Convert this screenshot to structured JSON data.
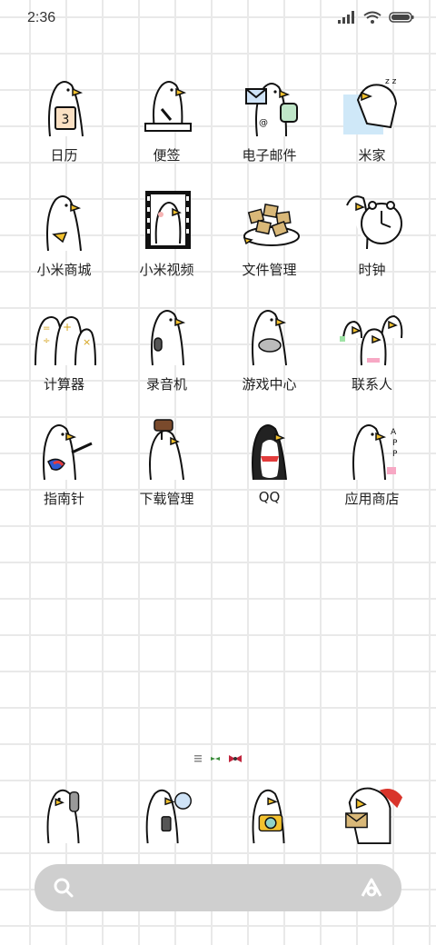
{
  "status_bar": {
    "time": "2:36",
    "icons": [
      "signal-icon",
      "wifi-icon",
      "battery-icon"
    ]
  },
  "apps": [
    {
      "label": "日历",
      "icon": "calendar-icon"
    },
    {
      "label": "便签",
      "icon": "notes-icon"
    },
    {
      "label": "电子邮件",
      "icon": "email-icon"
    },
    {
      "label": "米家",
      "icon": "mi-home-icon"
    },
    {
      "label": "小米商城",
      "icon": "mi-store-icon"
    },
    {
      "label": "小米视频",
      "icon": "mi-video-icon"
    },
    {
      "label": "文件管理",
      "icon": "file-manager-icon"
    },
    {
      "label": "时钟",
      "icon": "clock-icon"
    },
    {
      "label": "计算器",
      "icon": "calculator-icon"
    },
    {
      "label": "录音机",
      "icon": "recorder-icon"
    },
    {
      "label": "游戏中心",
      "icon": "game-center-icon"
    },
    {
      "label": "联系人",
      "icon": "contacts-icon"
    },
    {
      "label": "指南针",
      "icon": "compass-icon"
    },
    {
      "label": "下载管理",
      "icon": "downloads-icon"
    },
    {
      "label": "QQ",
      "icon": "qq-icon"
    },
    {
      "label": "应用商店",
      "icon": "app-store-icon"
    }
  ],
  "page_indicator": {
    "pages": 3,
    "current": 2
  },
  "dock": [
    {
      "icon": "phone-icon"
    },
    {
      "icon": "messages-icon"
    },
    {
      "icon": "camera-icon"
    },
    {
      "icon": "browser-icon"
    }
  ],
  "search_bar": {
    "icon_left": "search-icon",
    "icon_right": "assistant-icon"
  },
  "colors": {
    "beak": "#f2c12e",
    "grid_line": "#e9e9e9",
    "search_bg": "#cfcfcf"
  }
}
